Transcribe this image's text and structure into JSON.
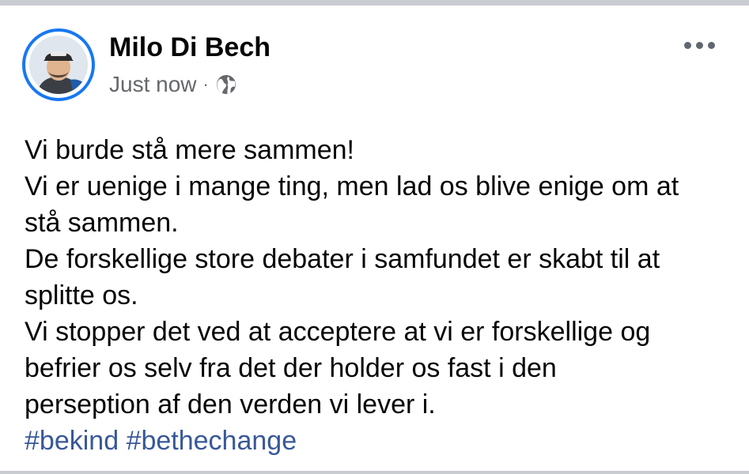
{
  "post": {
    "author": "Milo Di Bech",
    "timestamp": "Just now",
    "separator": "·",
    "privacy_icon": "globe-icon",
    "more_icon": "more-options-icon",
    "lines": [
      "Vi burde stå mere sammen!",
      "Vi er uenige i mange ting, men lad os blive enige om at",
      "stå sammen.",
      "De forskellige store debater i samfundet er skabt til at",
      "splitte os.",
      "Vi stopper det ved at acceptere at vi er forskellige og",
      "befrier os selv fra det der holder os fast i den",
      "perseption af den verden vi lever i."
    ],
    "hashtags": [
      "#bekind",
      "#bethechange"
    ]
  },
  "colors": {
    "accent": "#1877f2",
    "hashtag": "#385898",
    "meta_text": "#65676b",
    "divider": "#c9ccd1"
  }
}
